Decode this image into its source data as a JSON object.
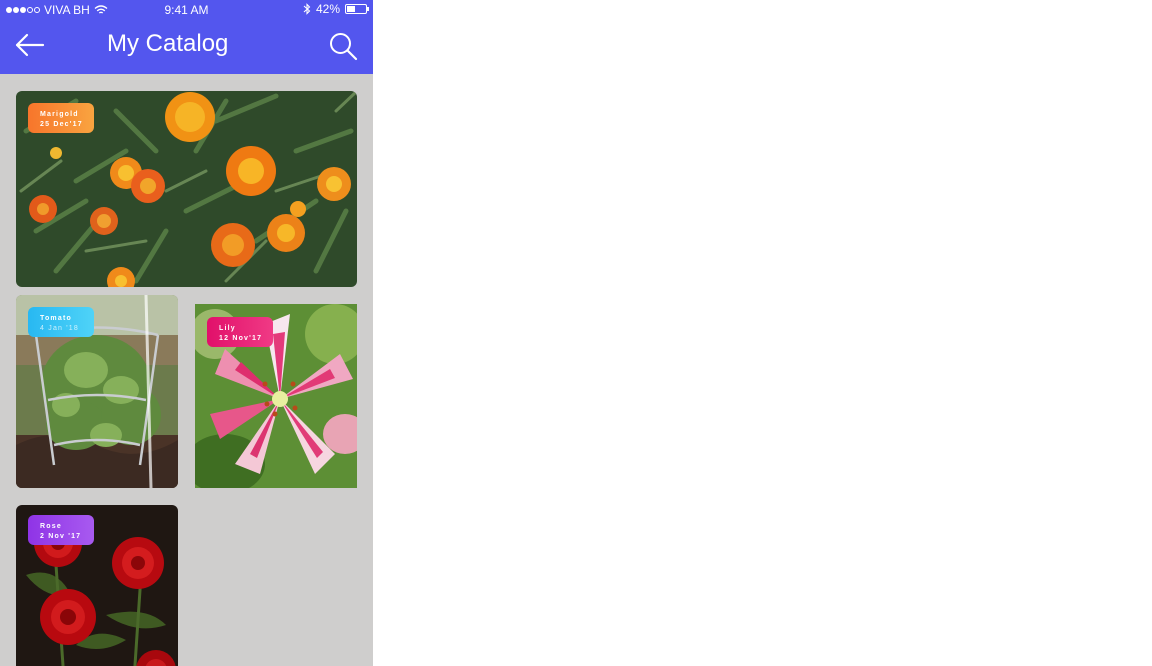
{
  "status_bar": {
    "carrier": "VIVA BH",
    "time": "9:41 AM",
    "battery": "42%",
    "battery_level": 0.42,
    "signal_bars_filled": 3,
    "signal_bars_total": 5,
    "icons": [
      "wifi-icon",
      "bluetooth-icon",
      "battery-icon"
    ]
  },
  "nav": {
    "title": "My Catalog",
    "back_icon": "arrow-left-icon",
    "search_icon": "search-icon"
  },
  "colors": {
    "brand": "#5356ee",
    "background": "#cfcecd",
    "tag_marigold": "#f58a2a",
    "tag_tomato": "#35c4f4",
    "tag_lily": "#e0116a",
    "tag_rose": "#8e3be0"
  },
  "catalog": [
    {
      "name": "Marigold",
      "date": "25 Dec'17"
    },
    {
      "name": "Tomato",
      "date": "4 Jan '18"
    },
    {
      "name": "Lily",
      "date": "12 Nov'17"
    },
    {
      "name": "Rose",
      "date": "2 Nov '17"
    }
  ]
}
